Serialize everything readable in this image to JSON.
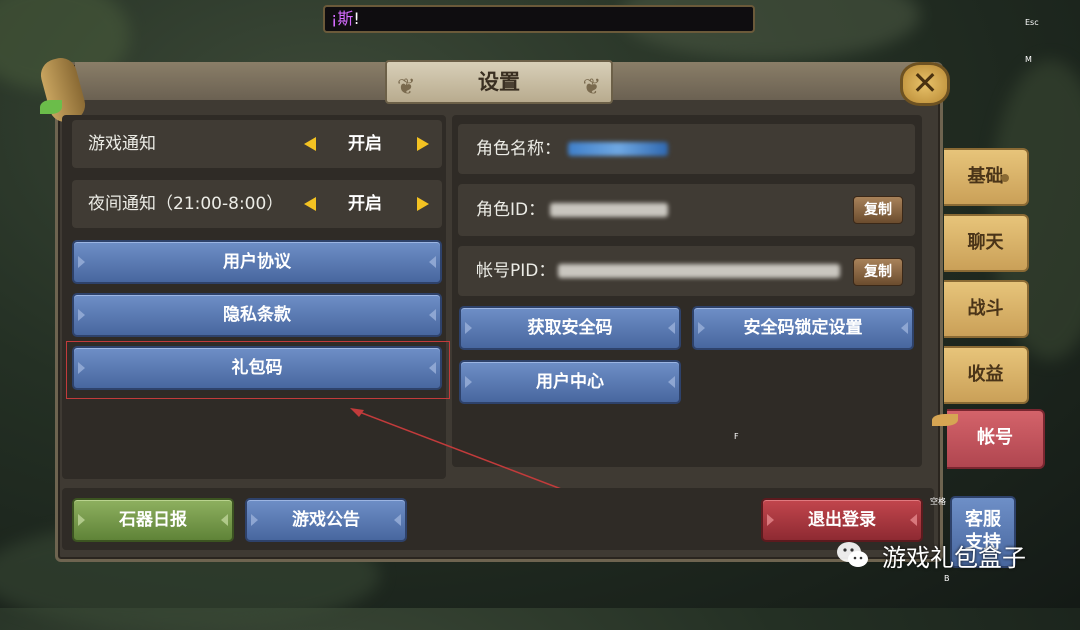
{
  "chat": {
    "channel": "¡斯",
    "suffix": "!"
  },
  "key_hints": {
    "esc": "Esc",
    "m": "M",
    "f": "F",
    "space": "空格",
    "b": "B"
  },
  "title": "设置",
  "left_panel": {
    "toggles": [
      {
        "label": "游戏通知",
        "value": "开启"
      },
      {
        "label": "夜间通知（21:00-8:00）",
        "value": "开启"
      }
    ],
    "buttons": [
      "用户协议",
      "隐私条款",
      "礼包码"
    ]
  },
  "right_panel": {
    "role_name_label": "角色名称：",
    "role_id_label": "角色ID：",
    "account_pid_label": "帐号PID：",
    "copy_label": "复制",
    "buttons": [
      "获取安全码",
      "安全码锁定设置",
      "用户中心"
    ]
  },
  "bottom": {
    "daily_report": "石器日报",
    "announcement": "游戏公告",
    "logout": "退出登录"
  },
  "side_tabs": [
    {
      "label": "基础",
      "active": false
    },
    {
      "label": "聊天",
      "active": false
    },
    {
      "label": "战斗",
      "active": false
    },
    {
      "label": "收益",
      "active": false
    },
    {
      "label": "帐号",
      "active": true
    }
  ],
  "support": {
    "line1": "客服",
    "line2": "支持"
  },
  "watermark": "游戏礼包盒子",
  "colors": {
    "accent_yellow": "#f3c222",
    "button_blue": "#5878b0",
    "active_tab_red": "#c2535b",
    "highlight_red": "#c23b3b"
  }
}
